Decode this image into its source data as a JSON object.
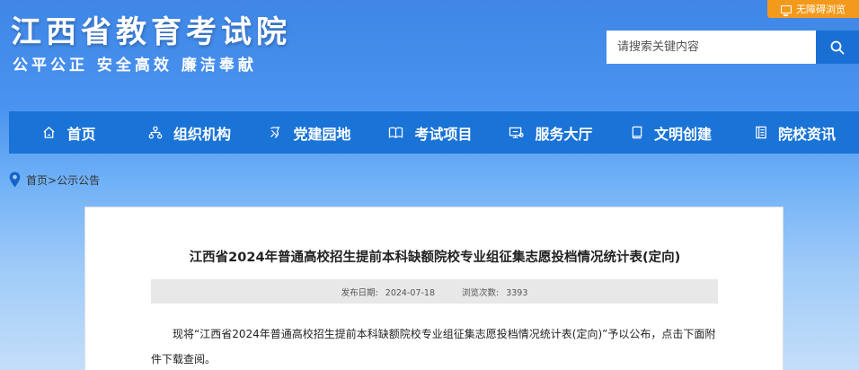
{
  "header": {
    "title": "江西省教育考试院",
    "slogan": "公平公正  安全高效  廉洁奉献",
    "accessibility_label": "无障碍浏览",
    "search_placeholder": "请搜索关键内容"
  },
  "nav": {
    "items": [
      {
        "label": "首页",
        "icon": "home-icon"
      },
      {
        "label": "组织机构",
        "icon": "org-chart-icon"
      },
      {
        "label": "党建园地",
        "icon": "party-icon"
      },
      {
        "label": "考试项目",
        "icon": "book-icon"
      },
      {
        "label": "服务大厅",
        "icon": "service-icon"
      },
      {
        "label": "文明创建",
        "icon": "document-icon"
      },
      {
        "label": "院校资讯",
        "icon": "news-icon"
      }
    ]
  },
  "breadcrumb": {
    "home": "首页",
    "separator": ">",
    "current": "公示公告"
  },
  "article": {
    "title": "江西省2024年普通高校招生提前本科缺额院校专业组征集志愿投档情况统计表(定向)",
    "date_label": "发布日期:",
    "date": "2024-07-18",
    "views_label": "浏览次数:",
    "views": "3393",
    "body": "现将“江西省2024年普通高校招生提前本科缺额院校专业组征集志愿投档情况统计表(定向)”予以公布，点击下面附件下载查阅。"
  },
  "colors": {
    "nav_bg": "#1a73d6",
    "accessibility_bg": "#f39a1c",
    "search_button_bg": "#1a6fd4"
  }
}
